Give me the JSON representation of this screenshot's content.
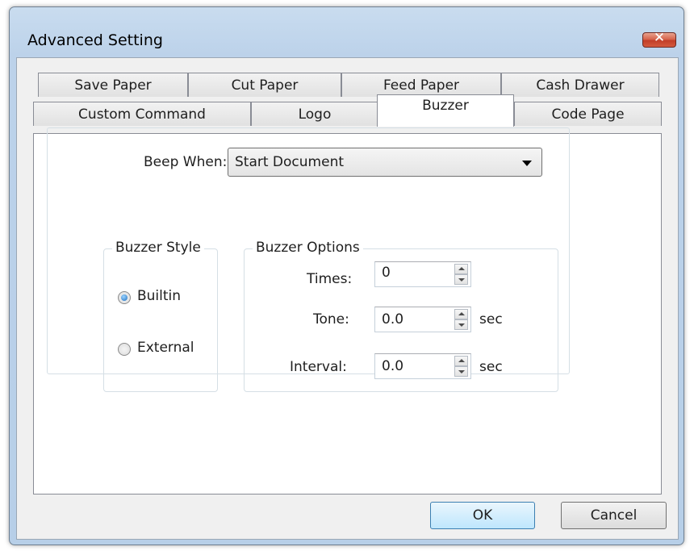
{
  "window": {
    "title": "Advanced Setting",
    "close_glyph": "✕"
  },
  "tabs": {
    "row1": [
      "Save Paper",
      "Cut Paper",
      "Feed Paper",
      "Cash Drawer"
    ],
    "row2": [
      "Custom Command",
      "Logo",
      "Buzzer",
      "Code Page"
    ],
    "active": "Buzzer"
  },
  "buzzer": {
    "beep_when_label": "Beep When:",
    "beep_when_value": "Start Document",
    "style_group_title": "Buzzer Style",
    "style_options": [
      "Builtin",
      "External"
    ],
    "style_selected": "Builtin",
    "options_group_title": "Buzzer Options",
    "times_label": "Times:",
    "times_value": "0",
    "tone_label": "Tone:",
    "tone_value": "0.0",
    "tone_unit": "sec",
    "interval_label": "Interval:",
    "interval_value": "0.0",
    "interval_unit": "sec"
  },
  "buttons": {
    "ok": "OK",
    "cancel": "Cancel"
  },
  "colors": {
    "title_bar": "#b9d1ea",
    "close_button": "#c9452e",
    "dialog_body": "#f0f0f0",
    "tab_page": "#ffffff"
  }
}
